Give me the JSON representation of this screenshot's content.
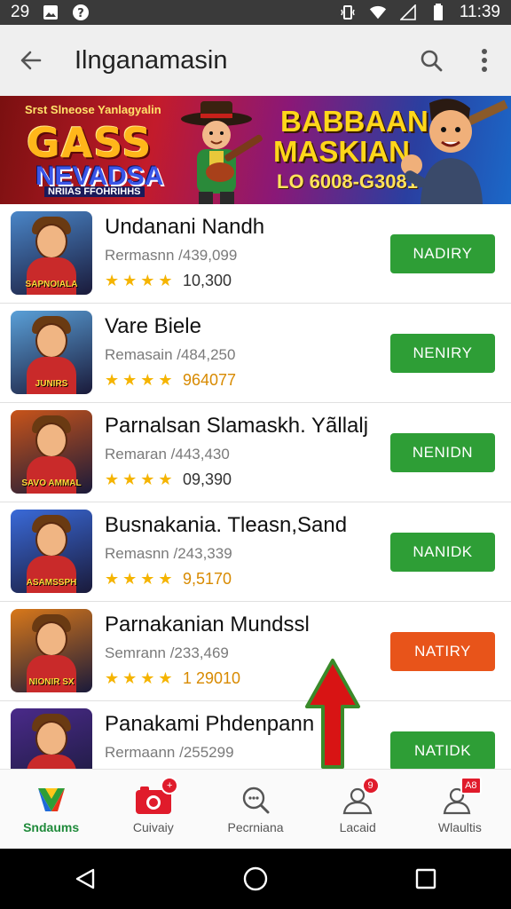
{
  "status_bar": {
    "time_left": "29",
    "time_right": "11:39"
  },
  "app_bar": {
    "title": "Ilnganamasin"
  },
  "banner": {
    "tagline": "Srst Slneose Yanlagyalin",
    "logo_top": "GASS",
    "logo_mid": "NEVADSA",
    "logo_bottom": "NRIIAS FFOHRIHHS",
    "headline_1": "BABBAAN",
    "headline_2": "MASKIAN",
    "headline_3": "LO 6008-G3081"
  },
  "apps": [
    {
      "name": "Undanani Nandh",
      "sub": "Rermasnn  /439,099",
      "count": "10,300",
      "count_color": "dark",
      "button": "NADIRY",
      "button_color": "#2e9e36",
      "thumb_bg": "#4a86c8",
      "thumb_cap": "SAPNOIALA"
    },
    {
      "name": "Vare Biele",
      "sub": "Remasain  /484,250",
      "count": "964077",
      "count_color": "orange",
      "button": "NENIRY",
      "button_color": "#2e9e36",
      "thumb_bg": "#5aa0d8",
      "thumb_cap": "JUNIRS"
    },
    {
      "name": "Parnalsan Slamaskh. Yãllalj",
      "sub": "Remaran  /443,430",
      "count": "09,390",
      "count_color": "dark",
      "button": "NENIDN",
      "button_color": "#2e9e36",
      "thumb_bg": "#c8541a",
      "thumb_cap": "SAVO AMMAL"
    },
    {
      "name": "Busnakania. Tleasn,Sand",
      "sub": "Remasnn  /243,339",
      "count": "9,5170",
      "count_color": "orange",
      "button": "NANIDK",
      "button_color": "#2e9e36",
      "thumb_bg": "#3a6ad8",
      "thumb_cap": "ASAMSSPH"
    },
    {
      "name": "Parnakanian Mundssl",
      "sub": "Semrann  /233,469",
      "count": "1 29010",
      "count_color": "orange",
      "button": "NATIRY",
      "button_color": "#e8541a",
      "thumb_bg": "#d8781a",
      "thumb_cap": "NIONIR SX"
    },
    {
      "name": "Panakami Phdenpann",
      "sub": "Rermaann  /255299",
      "count": "",
      "count_color": "dark",
      "button": "NATIDK",
      "button_color": "#2e9e36",
      "thumb_bg": "#4a2a8a",
      "thumb_cap": ""
    }
  ],
  "bottom_nav": [
    {
      "label": "Sndaums",
      "icon": "store-icon",
      "active": true,
      "badge": ""
    },
    {
      "label": "Cuivaiy",
      "icon": "camera-icon",
      "active": false,
      "badge": "+"
    },
    {
      "label": "Pecrniana",
      "icon": "search-icon",
      "active": false,
      "badge": ""
    },
    {
      "label": "Lacaid",
      "icon": "profile-icon",
      "active": false,
      "badge": "9"
    },
    {
      "label": "Wlaultis",
      "icon": "account-icon",
      "active": false,
      "badge": "A8"
    }
  ]
}
